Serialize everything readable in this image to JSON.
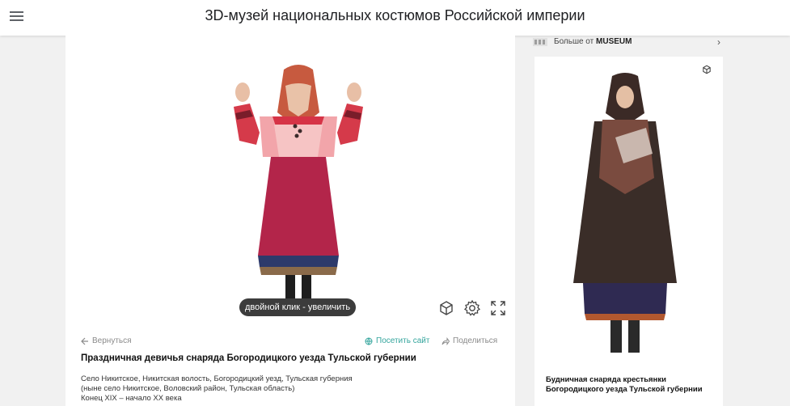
{
  "header": {
    "title": "3D-музей национальных костюмов Российской империи"
  },
  "viewer": {
    "hint": "двойной клик - увеличить"
  },
  "actions": {
    "back": "Вернуться",
    "visit": "Посетить сайт",
    "share": "Поделиться"
  },
  "item": {
    "title": "Праздничная девичья снаряда Богородицкого уезда Тульской губернии",
    "desc_line1": "Село Никитское, Никитская волость, Богородицкий уезд, Тульская губерния",
    "desc_line2": "(ныне село Никитское, Воловский район, Тульская область)",
    "desc_line3": "Конец XIX – начало XX века"
  },
  "sidebar": {
    "more_prefix": "Больше от",
    "more_source": "MUSEUM",
    "card_title_line1": "Будничная снаряда крестьянки",
    "card_title_line2": "Богородицкого уезда Тульской губернии"
  },
  "colors": {
    "accent": "#34a59d",
    "header_bg": "#ffffff",
    "page_bg": "#f1f1f1"
  }
}
